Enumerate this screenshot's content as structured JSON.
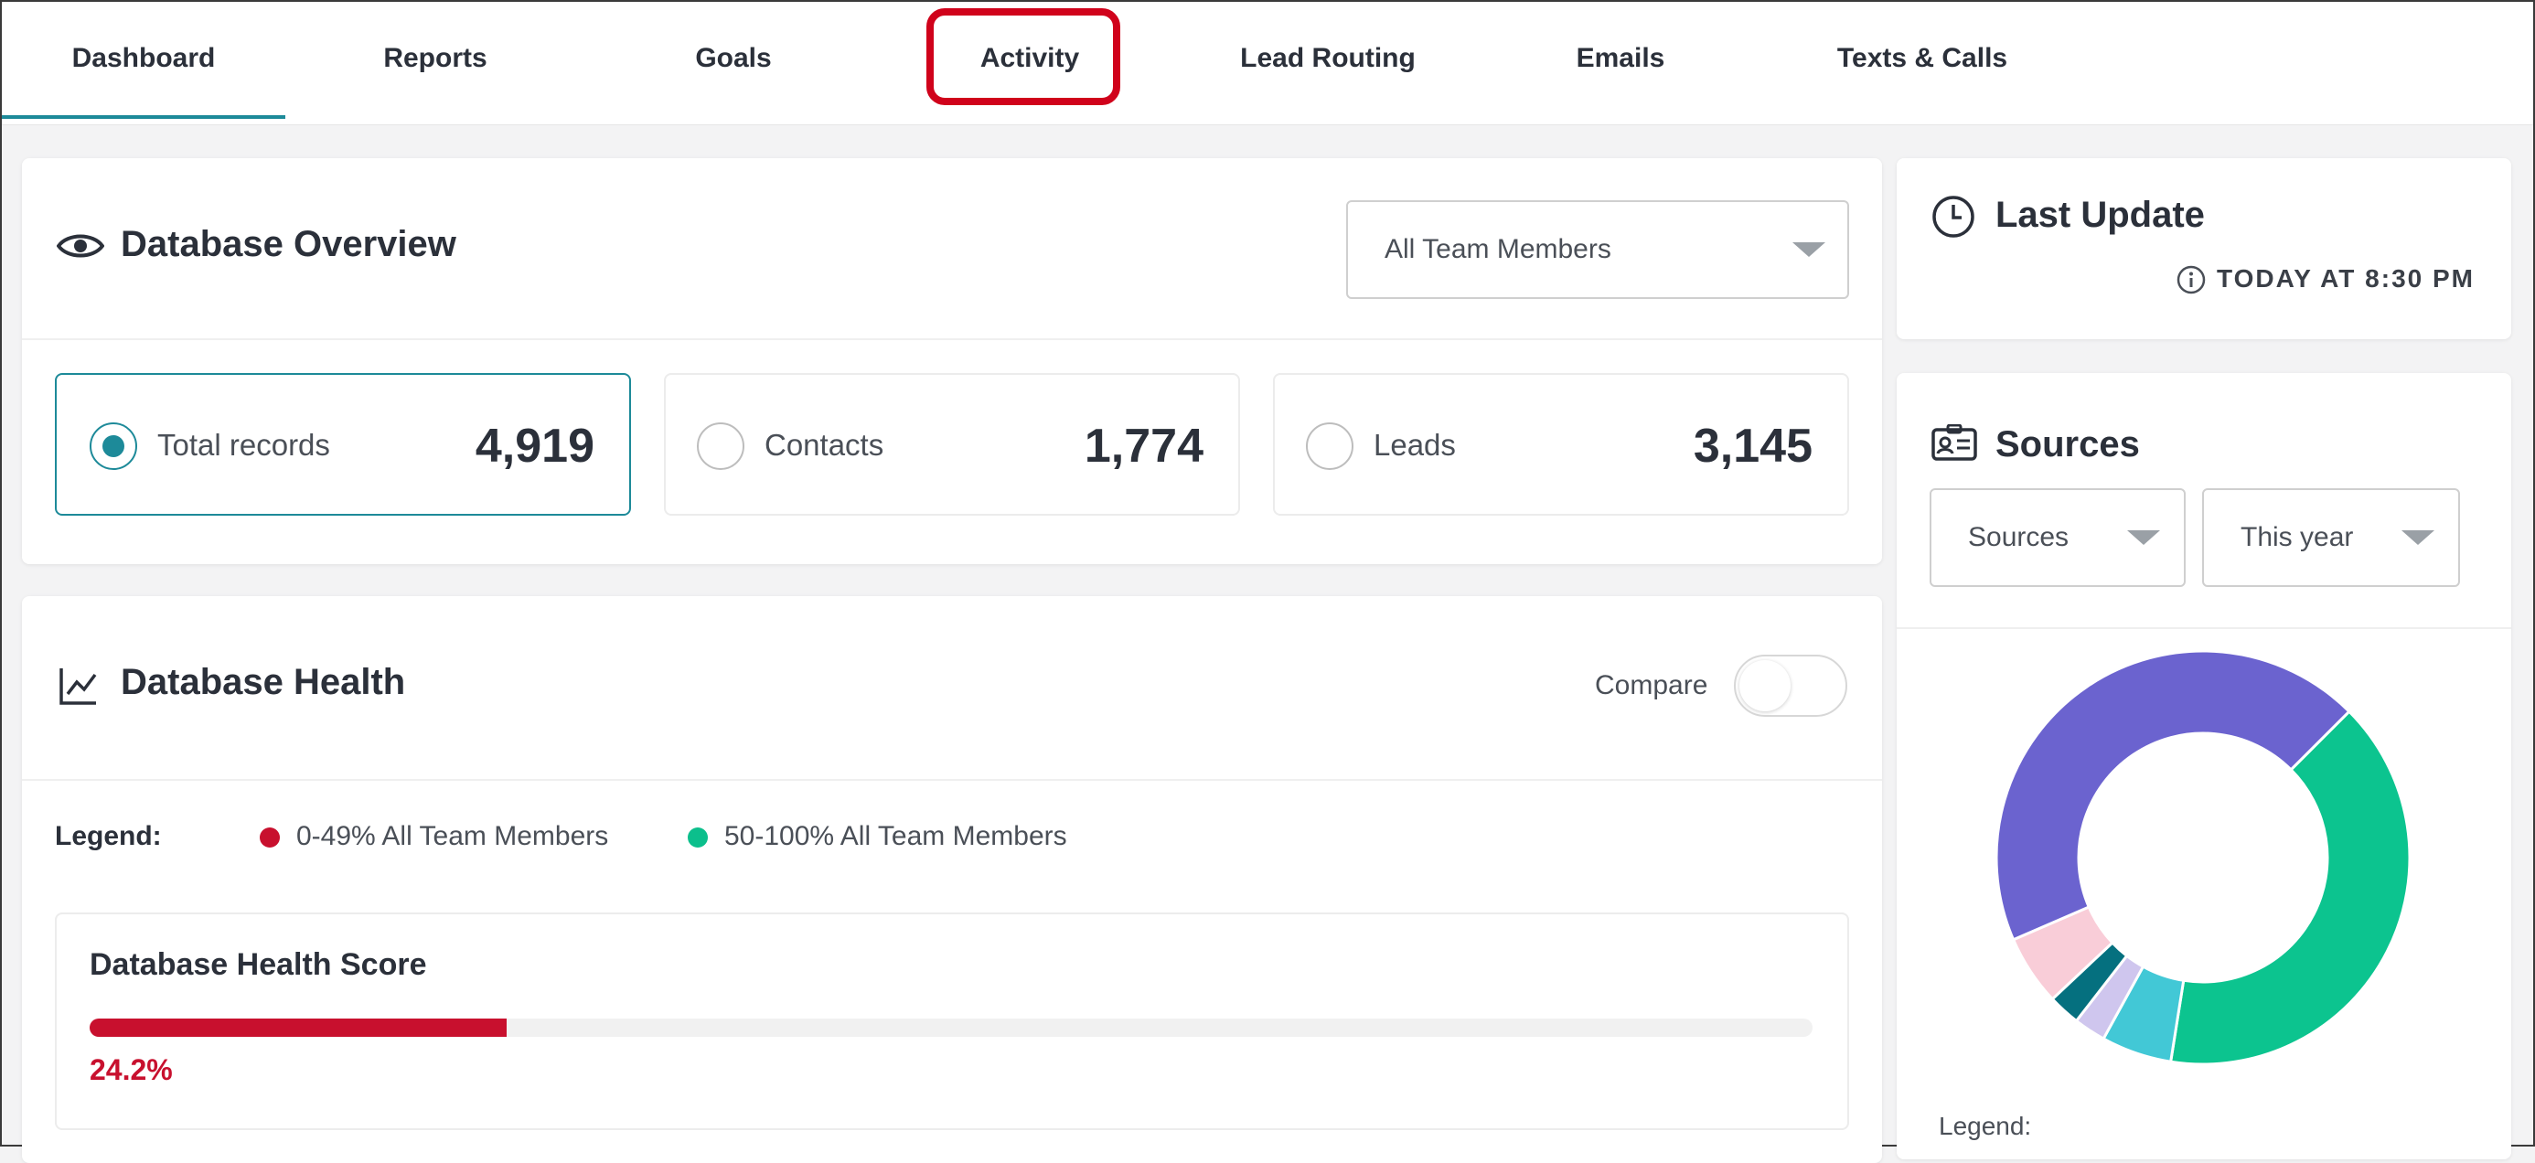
{
  "nav": {
    "tabs": [
      {
        "label": "Dashboard"
      },
      {
        "label": "Reports"
      },
      {
        "label": "Goals"
      },
      {
        "label": "Activity"
      },
      {
        "label": "Lead Routing"
      },
      {
        "label": "Emails"
      },
      {
        "label": "Texts & Calls"
      }
    ],
    "active": "Dashboard",
    "highlighted": "Activity",
    "highlight_color": "#d0021b"
  },
  "overview": {
    "title": "Database Overview",
    "member_select": "All Team Members",
    "stats": [
      {
        "label": "Total records",
        "value": "4,919",
        "selected": true
      },
      {
        "label": "Contacts",
        "value": "1,774",
        "selected": false
      },
      {
        "label": "Leads",
        "value": "3,145",
        "selected": false
      }
    ]
  },
  "health": {
    "title": "Database Health",
    "compare_label": "Compare",
    "compare_on": false,
    "legend_label": "Legend:",
    "legend": [
      {
        "label": "0-49% All Team Members",
        "color": "#c8102e"
      },
      {
        "label": "50-100% All Team Members",
        "color": "#0cbf8c"
      }
    ],
    "score_title": "Database Health Score",
    "score_text": "24.2%",
    "score_fraction": 0.242
  },
  "last_update": {
    "title": "Last Update",
    "time": "TODAY AT 8:30 PM"
  },
  "sources": {
    "title": "Sources",
    "select_type": "Sources",
    "select_period": "This year",
    "legend_label": "Legend:"
  },
  "colors": {
    "accent": "#1d8a99",
    "danger": "#c8102e"
  },
  "chart_data": {
    "type": "pie",
    "variant": "donut",
    "slices": [
      {
        "value": 40,
        "color": "#0cc48f"
      },
      {
        "value": 5.5,
        "color": "#42c8d6"
      },
      {
        "value": 2.5,
        "color": "#cfc6ee"
      },
      {
        "value": 2.5,
        "color": "#05707f"
      },
      {
        "value": 5.5,
        "color": "#f9cdd8"
      },
      {
        "value": 44,
        "color": "#6b63cf"
      }
    ]
  }
}
